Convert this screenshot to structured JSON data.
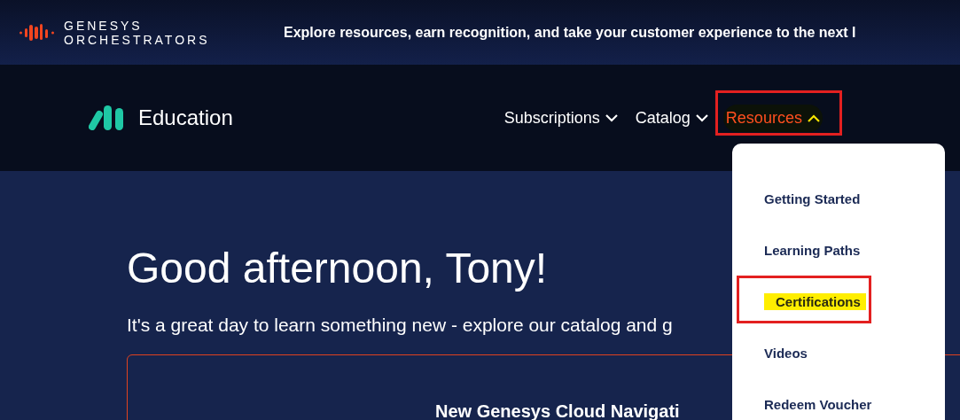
{
  "top_banner": {
    "brand_line_1": "GENESYS",
    "brand_line_2": "ORCHESTRATORS",
    "tagline": "Explore resources, earn recognition, and take your customer experience to the next l"
  },
  "header": {
    "logo_text": "Education",
    "nav": [
      {
        "label": "Subscriptions",
        "expanded": false,
        "annotated": false
      },
      {
        "label": "Catalog",
        "expanded": false,
        "annotated": false
      },
      {
        "label": "Resources",
        "expanded": true,
        "annotated": true
      }
    ]
  },
  "dropdown": {
    "items": [
      {
        "label": "Getting Started",
        "annotated": false
      },
      {
        "label": "Learning Paths",
        "annotated": false
      },
      {
        "label": "Certifications",
        "annotated": true
      },
      {
        "label": "Videos",
        "annotated": false
      },
      {
        "label": "Redeem Voucher",
        "annotated": false
      }
    ]
  },
  "main": {
    "greeting": "Good afternoon, Tony!",
    "subtitle": "It's a great day to learn something new - explore our catalog and g",
    "card_heading": "New Genesys Cloud Navigati"
  }
}
